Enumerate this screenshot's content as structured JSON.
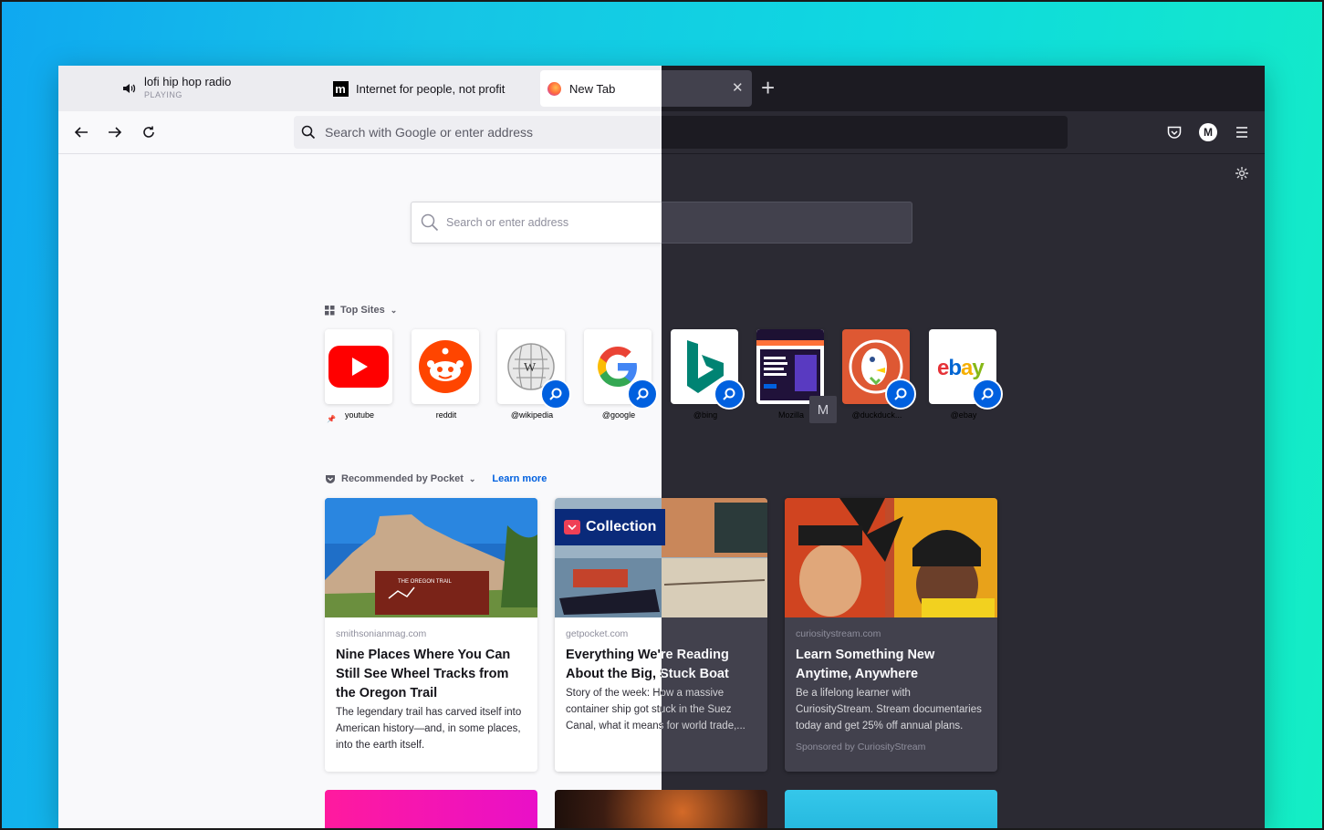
{
  "tabs": [
    {
      "title": "lofi hip hop radio",
      "subtitle": "PLAYING"
    },
    {
      "title": "Internet for people, not profit"
    },
    {
      "title": "New Tab"
    }
  ],
  "toolbar": {
    "urlbar_placeholder": "Search with Google or enter address",
    "account_initial": "M"
  },
  "newtab": {
    "search_placeholder": "Search or enter address",
    "top_sites_label": "Top Sites",
    "top_sites": [
      {
        "label": "youtube",
        "icon": "youtube-icon"
      },
      {
        "label": "reddit",
        "icon": "reddit-icon"
      },
      {
        "label": "@wikipedia",
        "icon": "wikipedia-icon"
      },
      {
        "label": "@google",
        "icon": "google-icon"
      },
      {
        "label": "@bing",
        "icon": "bing-icon"
      },
      {
        "label": "Mozilla",
        "icon": "mozilla-screenshot",
        "fallback": "M"
      },
      {
        "label": "@duckduck...",
        "icon": "duckduckgo-icon"
      },
      {
        "label": "@ebay",
        "icon": "ebay-icon"
      }
    ],
    "pocket_label": "Recommended by Pocket",
    "learn_more": "Learn more",
    "stories": [
      {
        "source": "smithsonianmag.com",
        "title": "Nine Places Where You Can Still See Wheel Tracks from the Oregon Trail",
        "excerpt": "The legendary trail has carved itself into American history—and, in some places, into the earth itself."
      },
      {
        "tag": "Collection",
        "source": "getpocket.com",
        "title": "Everything We're Reading About the Big, Stuck Boat",
        "excerpt": "Story of the week: How a massive container ship got stuck in the Suez Canal, what it means for world trade,..."
      },
      {
        "source": "curiositystream.com",
        "title": "Learn Something New Anytime, Anywhere",
        "excerpt": "Be a lifelong learner with CuriosityStream. Stream documentaries today and get 25% off annual plans.",
        "sponsor": "Sponsored by CuriosityStream"
      }
    ]
  },
  "colors": {
    "accent": "#0060df",
    "pocket": "#ef4056",
    "dark_bg": "#2b2a33",
    "light_bg": "#f9f9fb"
  }
}
